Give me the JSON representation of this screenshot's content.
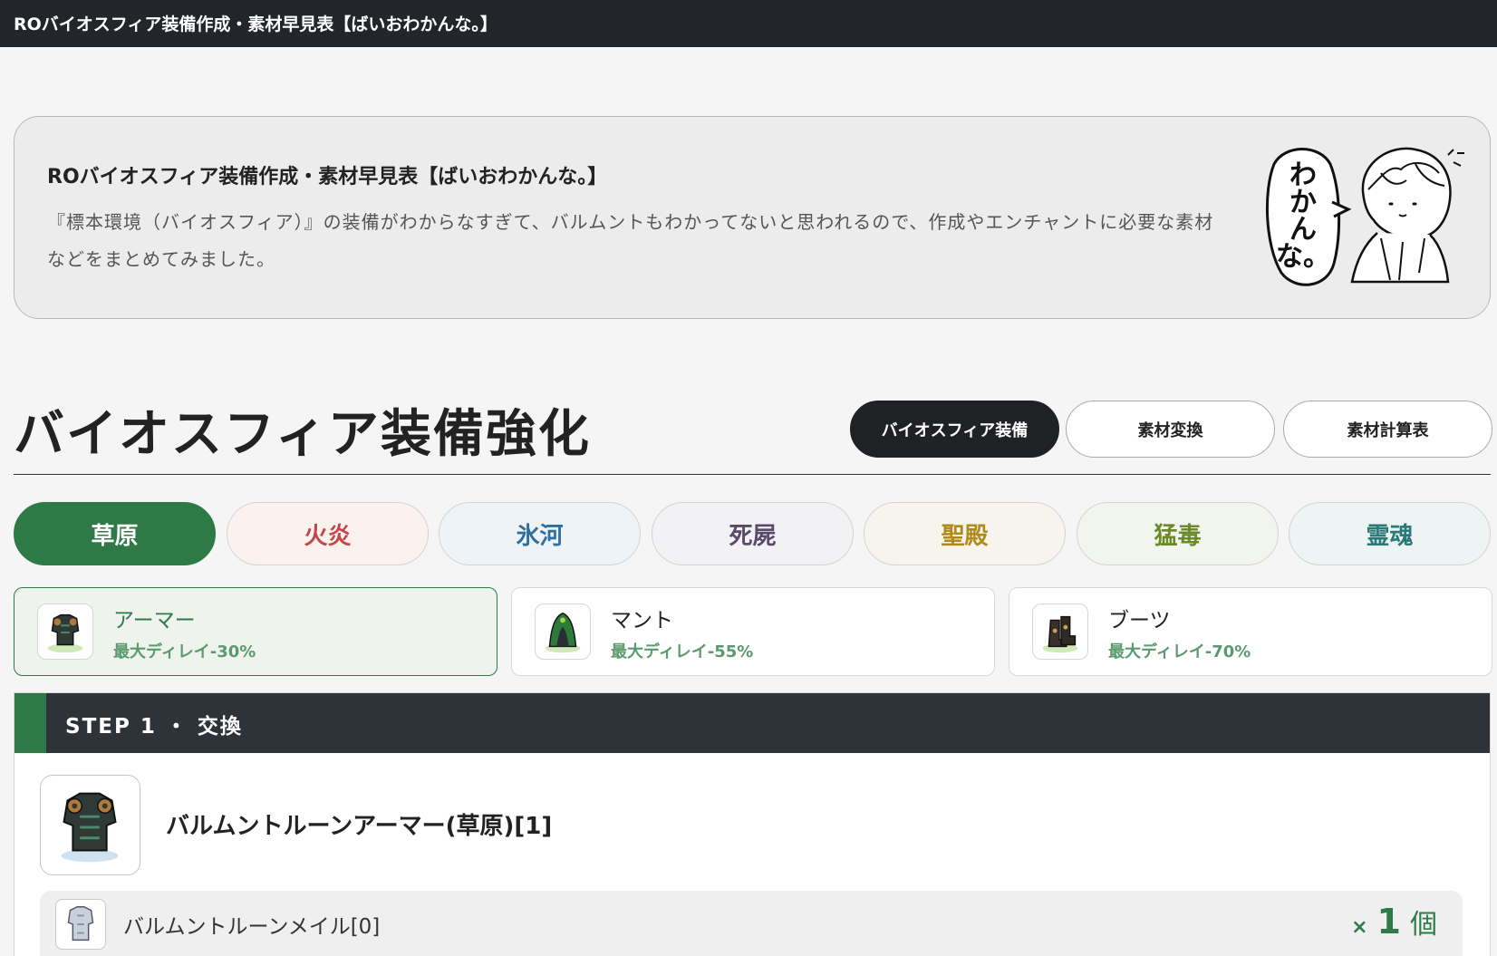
{
  "topbar": {
    "title": "ROバイオスフィア装備作成・素材早見表【ばいおわかんな。】"
  },
  "hero": {
    "title": "ROバイオスフィア装備作成・素材早見表【ばいおわかんな。】",
    "description": "『標本環境（バイオスフィア）』の装備がわからなすぎて、バルムントもわかってないと思われるので、作成やエンチャントに必要な素材などをまとめてみました。",
    "mascot_text": "わかんな。"
  },
  "section": {
    "title": "バイオスフィア装備強化"
  },
  "nav": [
    {
      "label": "バイオスフィア装備",
      "active": true
    },
    {
      "label": "素材変換",
      "active": false
    },
    {
      "label": "素材計算表",
      "active": false
    }
  ],
  "elements": [
    {
      "label": "草原",
      "active": true,
      "color": "#2d7a46"
    },
    {
      "label": "火炎",
      "color": "#c04848"
    },
    {
      "label": "氷河",
      "color": "#2f6fa0"
    },
    {
      "label": "死屍",
      "color": "#5a4a6a"
    },
    {
      "label": "聖殿",
      "color": "#b08a1a"
    },
    {
      "label": "猛毒",
      "color": "#6a8a2a"
    },
    {
      "label": "霊魂",
      "color": "#2a7a78"
    }
  ],
  "equipment": [
    {
      "name": "アーマー",
      "sub": "最大ディレイ-30%",
      "icon": "armor-icon",
      "active": true
    },
    {
      "name": "マント",
      "sub": "最大ディレイ-55%",
      "icon": "cloak-icon",
      "active": false
    },
    {
      "name": "ブーツ",
      "sub": "最大ディレイ-70%",
      "icon": "boots-icon",
      "active": false
    }
  ],
  "step": {
    "label": "STEP 1 ・ 交換",
    "result": {
      "name": "バルムントルーンアーマー(草原)[1]",
      "icon": "rune-armor-icon"
    },
    "materials": [
      {
        "name": "バルムントルーンメイル[0]",
        "qty_prefix": "×",
        "qty": "1",
        "unit": "個",
        "icon": "rune-mail-icon"
      }
    ]
  },
  "colors": {
    "accent": "#2d7a46",
    "dark": "#22252a"
  }
}
